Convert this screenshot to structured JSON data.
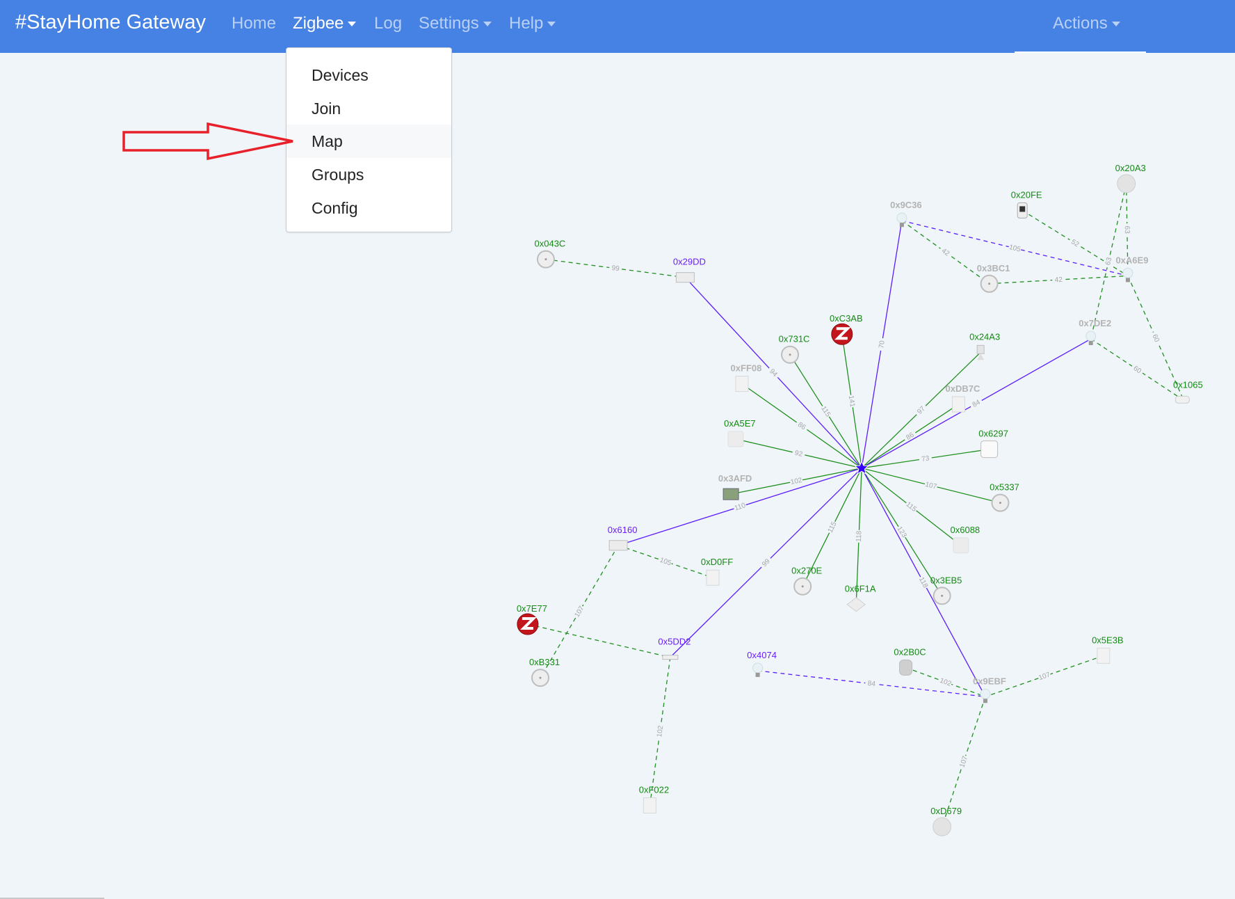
{
  "navbar": {
    "brand": "#StayHome Gateway",
    "items": [
      {
        "label": "Home",
        "dropdown": false,
        "active": false
      },
      {
        "label": "Zigbee",
        "dropdown": true,
        "active": true
      },
      {
        "label": "Log",
        "dropdown": false,
        "active": false
      },
      {
        "label": "Settings",
        "dropdown": true,
        "active": false
      },
      {
        "label": "Help",
        "dropdown": true,
        "active": false
      }
    ],
    "actions": {
      "label": "Actions",
      "dropdown": true
    }
  },
  "zigbee_menu": {
    "items": [
      {
        "label": "Devices"
      },
      {
        "label": "Join"
      },
      {
        "label": "Map",
        "highlighted": true
      },
      {
        "label": "Groups"
      },
      {
        "label": "Config"
      }
    ]
  },
  "annotation": {
    "type": "arrow",
    "color": "#e8202a",
    "points_to": "Map"
  },
  "colors": {
    "navbar": "#4582e3",
    "online": "#138a13",
    "router": "#6a1cff",
    "offline": "#b3b3b3",
    "link_green": "#1f8f1f",
    "link_purple": "#5a1cff",
    "coordinator": "#3300ff"
  },
  "map": {
    "coordinator": {
      "icon": "star-icon"
    },
    "nodes": [
      {
        "id": "0x043C",
        "status": "online",
        "icon": "round"
      },
      {
        "id": "0x29DD",
        "status": "router",
        "icon": "box"
      },
      {
        "id": "0x731C",
        "status": "online",
        "icon": "round"
      },
      {
        "id": "0xC3AB",
        "status": "online",
        "icon": "zigbee"
      },
      {
        "id": "0xFF08",
        "status": "offline",
        "icon": "switch"
      },
      {
        "id": "0xA5E7",
        "status": "online",
        "icon": "cube"
      },
      {
        "id": "0x3AFD",
        "status": "offline",
        "icon": "keypad"
      },
      {
        "id": "0x6160",
        "status": "router",
        "icon": "box"
      },
      {
        "id": "0xD0FF",
        "status": "online",
        "icon": "switch"
      },
      {
        "id": "0x7E77",
        "status": "online",
        "icon": "zigbee"
      },
      {
        "id": "0xB331",
        "status": "online",
        "icon": "round"
      },
      {
        "id": "0x5DD2",
        "status": "router",
        "icon": "strip"
      },
      {
        "id": "0xF022",
        "status": "online",
        "icon": "switch"
      },
      {
        "id": "0x270E",
        "status": "online",
        "icon": "round"
      },
      {
        "id": "0x6F1A",
        "status": "online",
        "icon": "diamond"
      },
      {
        "id": "0x3EB5",
        "status": "online",
        "icon": "round"
      },
      {
        "id": "0x6088",
        "status": "online",
        "icon": "cube"
      },
      {
        "id": "0x5337",
        "status": "online",
        "icon": "round"
      },
      {
        "id": "0x6297",
        "status": "online",
        "icon": "square"
      },
      {
        "id": "0xDB7C",
        "status": "offline",
        "icon": "switch"
      },
      {
        "id": "0x24A3",
        "status": "online",
        "icon": "sensor"
      },
      {
        "id": "0x7DE2",
        "status": "offline",
        "icon": "bulb"
      },
      {
        "id": "0x1065",
        "status": "online",
        "icon": "contact"
      },
      {
        "id": "0xA6E9",
        "status": "offline",
        "icon": "bulb"
      },
      {
        "id": "0x20A3",
        "status": "online",
        "icon": "ball"
      },
      {
        "id": "0x20FE",
        "status": "online",
        "icon": "thermostat"
      },
      {
        "id": "0x9C36",
        "status": "offline",
        "icon": "bulb"
      },
      {
        "id": "0x3BC1",
        "status": "offline",
        "icon": "round"
      },
      {
        "id": "0x4074",
        "status": "router",
        "icon": "bulb"
      },
      {
        "id": "0x2B0C",
        "status": "online",
        "icon": "cylinder"
      },
      {
        "id": "0x9EBF",
        "status": "offline",
        "icon": "bulb"
      },
      {
        "id": "0x5E3B",
        "status": "online",
        "icon": "switch"
      },
      {
        "id": "0xD679",
        "status": "online",
        "icon": "ball"
      }
    ],
    "links": [
      {
        "from": "coordinator",
        "to": "0x29DD",
        "lqi": 94,
        "color": "purple",
        "style": "solid"
      },
      {
        "from": "coordinator",
        "to": "0x731C",
        "lqi": 115,
        "color": "green",
        "style": "solid"
      },
      {
        "from": "coordinator",
        "to": "0xC3AB",
        "lqi": 141,
        "color": "green",
        "style": "solid"
      },
      {
        "from": "coordinator",
        "to": "0x9C36",
        "lqi": 70,
        "color": "purple",
        "style": "solid"
      },
      {
        "from": "coordinator",
        "to": "0xFF08",
        "lqi": 86,
        "color": "green",
        "style": "solid"
      },
      {
        "from": "coordinator",
        "to": "0xA5E7",
        "lqi": 92,
        "color": "green",
        "style": "solid"
      },
      {
        "from": "coordinator",
        "to": "0x3AFD",
        "lqi": 102,
        "color": "green",
        "style": "solid"
      },
      {
        "from": "coordinator",
        "to": "0x6160",
        "lqi": 110,
        "color": "purple",
        "style": "solid"
      },
      {
        "from": "coordinator",
        "to": "0x5DD2",
        "lqi": 99,
        "color": "purple",
        "style": "solid"
      },
      {
        "from": "coordinator",
        "to": "0x270E",
        "lqi": 115,
        "color": "green",
        "style": "solid"
      },
      {
        "from": "coordinator",
        "to": "0x6F1A",
        "lqi": 118,
        "color": "green",
        "style": "solid"
      },
      {
        "from": "coordinator",
        "to": "0x3EB5",
        "lqi": 123,
        "color": "green",
        "style": "solid"
      },
      {
        "from": "coordinator",
        "to": "0x9EBF",
        "lqi": 118,
        "color": "purple",
        "style": "solid"
      },
      {
        "from": "coordinator",
        "to": "0x6088",
        "lqi": 115,
        "color": "green",
        "style": "solid"
      },
      {
        "from": "coordinator",
        "to": "0x5337",
        "lqi": 107,
        "color": "green",
        "style": "solid"
      },
      {
        "from": "coordinator",
        "to": "0x6297",
        "lqi": 73,
        "color": "green",
        "style": "solid"
      },
      {
        "from": "coordinator",
        "to": "0xDB7C",
        "lqi": 86,
        "color": "green",
        "style": "solid"
      },
      {
        "from": "coordinator",
        "to": "0x24A3",
        "lqi": 97,
        "color": "green",
        "style": "solid"
      },
      {
        "from": "coordinator",
        "to": "0x7DE2",
        "lqi": 84,
        "color": "purple",
        "style": "solid"
      },
      {
        "from": "0x043C",
        "to": "0x29DD",
        "lqi": 99,
        "color": "green",
        "style": "dashed"
      },
      {
        "from": "0x9C36",
        "to": "0xA6E9",
        "lqi": 105,
        "color": "purple",
        "style": "dashed"
      },
      {
        "from": "0x9C36",
        "to": "0x3BC1",
        "lqi": 42,
        "color": "green",
        "style": "dashed"
      },
      {
        "from": "0x3BC1",
        "to": "0xA6E9",
        "lqi": 42,
        "color": "green",
        "style": "dashed"
      },
      {
        "from": "0x20FE",
        "to": "0xA6E9",
        "lqi": 52,
        "color": "green",
        "style": "dashed"
      },
      {
        "from": "0x20A3",
        "to": "0xA6E9",
        "lqi": 63,
        "color": "green",
        "style": "dashed"
      },
      {
        "from": "0x20A3",
        "to": "0x7DE2",
        "lqi": 63,
        "color": "green",
        "style": "dashed"
      },
      {
        "from": "0xA6E9",
        "to": "0x1065",
        "lqi": 60,
        "color": "green",
        "style": "dashed"
      },
      {
        "from": "0x7DE2",
        "to": "0x1065",
        "lqi": 60,
        "color": "green",
        "style": "dashed"
      },
      {
        "from": "0x6160",
        "to": "0xD0FF",
        "lqi": 105,
        "color": "green",
        "style": "dashed"
      },
      {
        "from": "0x6160",
        "to": "0xB331",
        "lqi": 107,
        "color": "green",
        "style": "dashed"
      },
      {
        "from": "0x7E77",
        "to": "0x5DD2",
        "lqi": null,
        "color": "green",
        "style": "dashed"
      },
      {
        "from": "0x5DD2",
        "to": "0xF022",
        "lqi": 102,
        "color": "green",
        "style": "dashed"
      },
      {
        "from": "0x4074",
        "to": "0x9EBF",
        "lqi": 84,
        "color": "purple",
        "style": "dashed"
      },
      {
        "from": "0x2B0C",
        "to": "0x9EBF",
        "lqi": 102,
        "color": "green",
        "style": "dashed"
      },
      {
        "from": "0x5E3B",
        "to": "0x9EBF",
        "lqi": 107,
        "color": "green",
        "style": "dashed"
      },
      {
        "from": "0x9EBF",
        "to": "0xD679",
        "lqi": 107,
        "color": "green",
        "style": "dashed"
      }
    ]
  }
}
